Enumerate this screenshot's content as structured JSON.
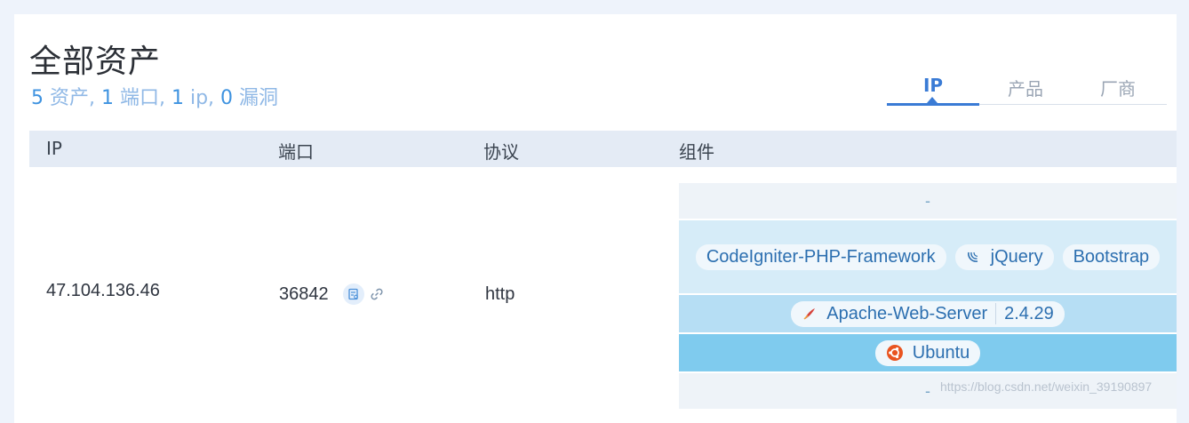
{
  "page": {
    "title": "全部资产",
    "summary": {
      "assets_count": "5",
      "assets_label": " 资产, ",
      "ports_count": "1",
      "ports_label": " 端口, ",
      "ip_count": "1",
      "ip_label": " ip, ",
      "vuln_count": "0",
      "vuln_label": " 漏洞"
    }
  },
  "tabs": [
    {
      "label": "IP",
      "active": true
    },
    {
      "label": "产品",
      "active": false
    },
    {
      "label": "厂商",
      "active": false
    }
  ],
  "table": {
    "headers": [
      "IP",
      "端口",
      "协议",
      "组件"
    ],
    "row": {
      "ip": "47.104.136.46",
      "port": "36842",
      "protocol": "http"
    }
  },
  "components": {
    "row0_dash": "-",
    "row1": [
      "CodeIgniter-PHP-Framework",
      "jQuery",
      "Bootstrap"
    ],
    "row2": {
      "name": "Apache-Web-Server",
      "version": "2.4.29"
    },
    "row3": "Ubuntu",
    "row4_dash": "-"
  },
  "watermark": "https://blog.csdn.net/weixin_39190897",
  "colors": {
    "accent": "#3a7bd5",
    "summary_blue": "#3f93e0",
    "header_bg": "#e4ebf5"
  },
  "icons": {
    "port_detail": "report-icon",
    "port_link": "link-icon",
    "jquery": "jquery-logo-icon",
    "apache": "apache-feather-icon",
    "ubuntu": "ubuntu-logo-icon"
  }
}
